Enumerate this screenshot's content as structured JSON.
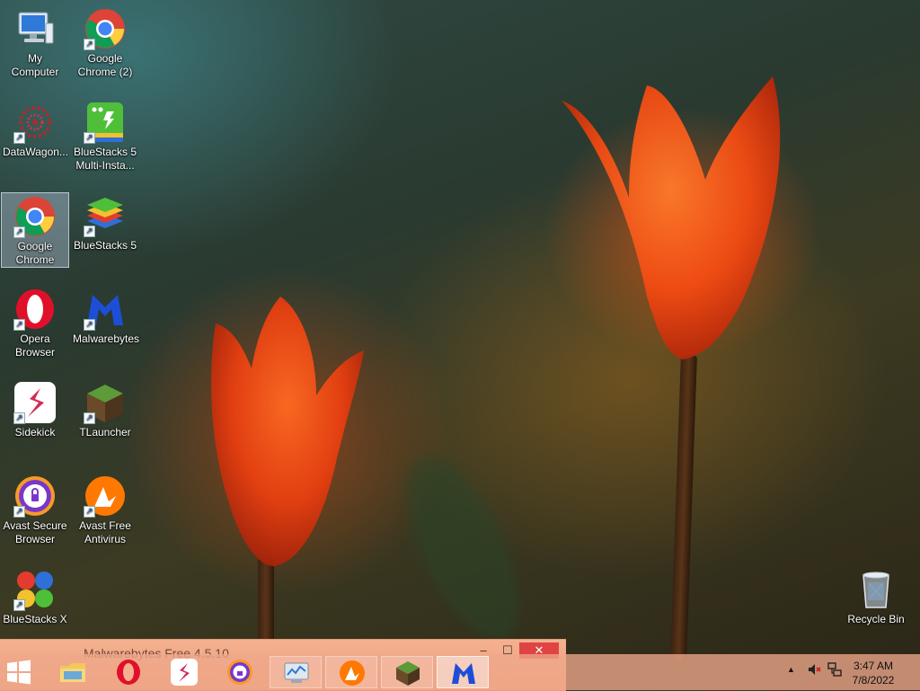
{
  "desktop_icons": [
    {
      "name": "my-computer",
      "label": "My Computer",
      "shortcut": false
    },
    {
      "name": "google-chrome-2",
      "label": "Google Chrome (2)",
      "shortcut": true
    },
    {
      "name": "datawagon",
      "label": "DataWagon...",
      "shortcut": true
    },
    {
      "name": "bluestacks-5-multi",
      "label": "BlueStacks 5 Multi-Insta...",
      "shortcut": true
    },
    {
      "name": "google-chrome",
      "label": "Google Chrome",
      "shortcut": true,
      "selected": true
    },
    {
      "name": "bluestacks-5",
      "label": "BlueStacks 5",
      "shortcut": true
    },
    {
      "name": "opera-browser",
      "label": "Opera Browser",
      "shortcut": true
    },
    {
      "name": "malwarebytes",
      "label": "Malwarebytes",
      "shortcut": true
    },
    {
      "name": "sidekick",
      "label": "Sidekick",
      "shortcut": true
    },
    {
      "name": "tlauncher",
      "label": "TLauncher",
      "shortcut": true
    },
    {
      "name": "avast-secure-browser",
      "label": "Avast Secure Browser",
      "shortcut": true
    },
    {
      "name": "avast-free-antivirus",
      "label": "Avast Free Antivirus",
      "shortcut": true
    },
    {
      "name": "bluestacks-x",
      "label": "BlueStacks X",
      "shortcut": true
    },
    {
      "name": "recycle-bin",
      "label": "Recycle Bin",
      "shortcut": false
    }
  ],
  "window": {
    "title": "Malwarebytes Free  4.5.10",
    "minimize": "–",
    "maximize": "☐",
    "close": "✕"
  },
  "taskbar": {
    "items": [
      {
        "name": "file-explorer",
        "state": "pinned"
      },
      {
        "name": "opera",
        "state": "pinned"
      },
      {
        "name": "sidekick",
        "state": "pinned"
      },
      {
        "name": "avast-secure-browser",
        "state": "pinned"
      },
      {
        "name": "task-manager",
        "state": "running"
      },
      {
        "name": "avast-antivirus",
        "state": "running"
      },
      {
        "name": "tlauncher",
        "state": "running"
      },
      {
        "name": "malwarebytes",
        "state": "active"
      }
    ]
  },
  "tray": {
    "time": "3:47 AM",
    "date": "7/8/2022"
  },
  "colors": {
    "taskbar": "#eea88a",
    "window_titlebar": "#f4b18f",
    "close_button": "#e04343"
  }
}
